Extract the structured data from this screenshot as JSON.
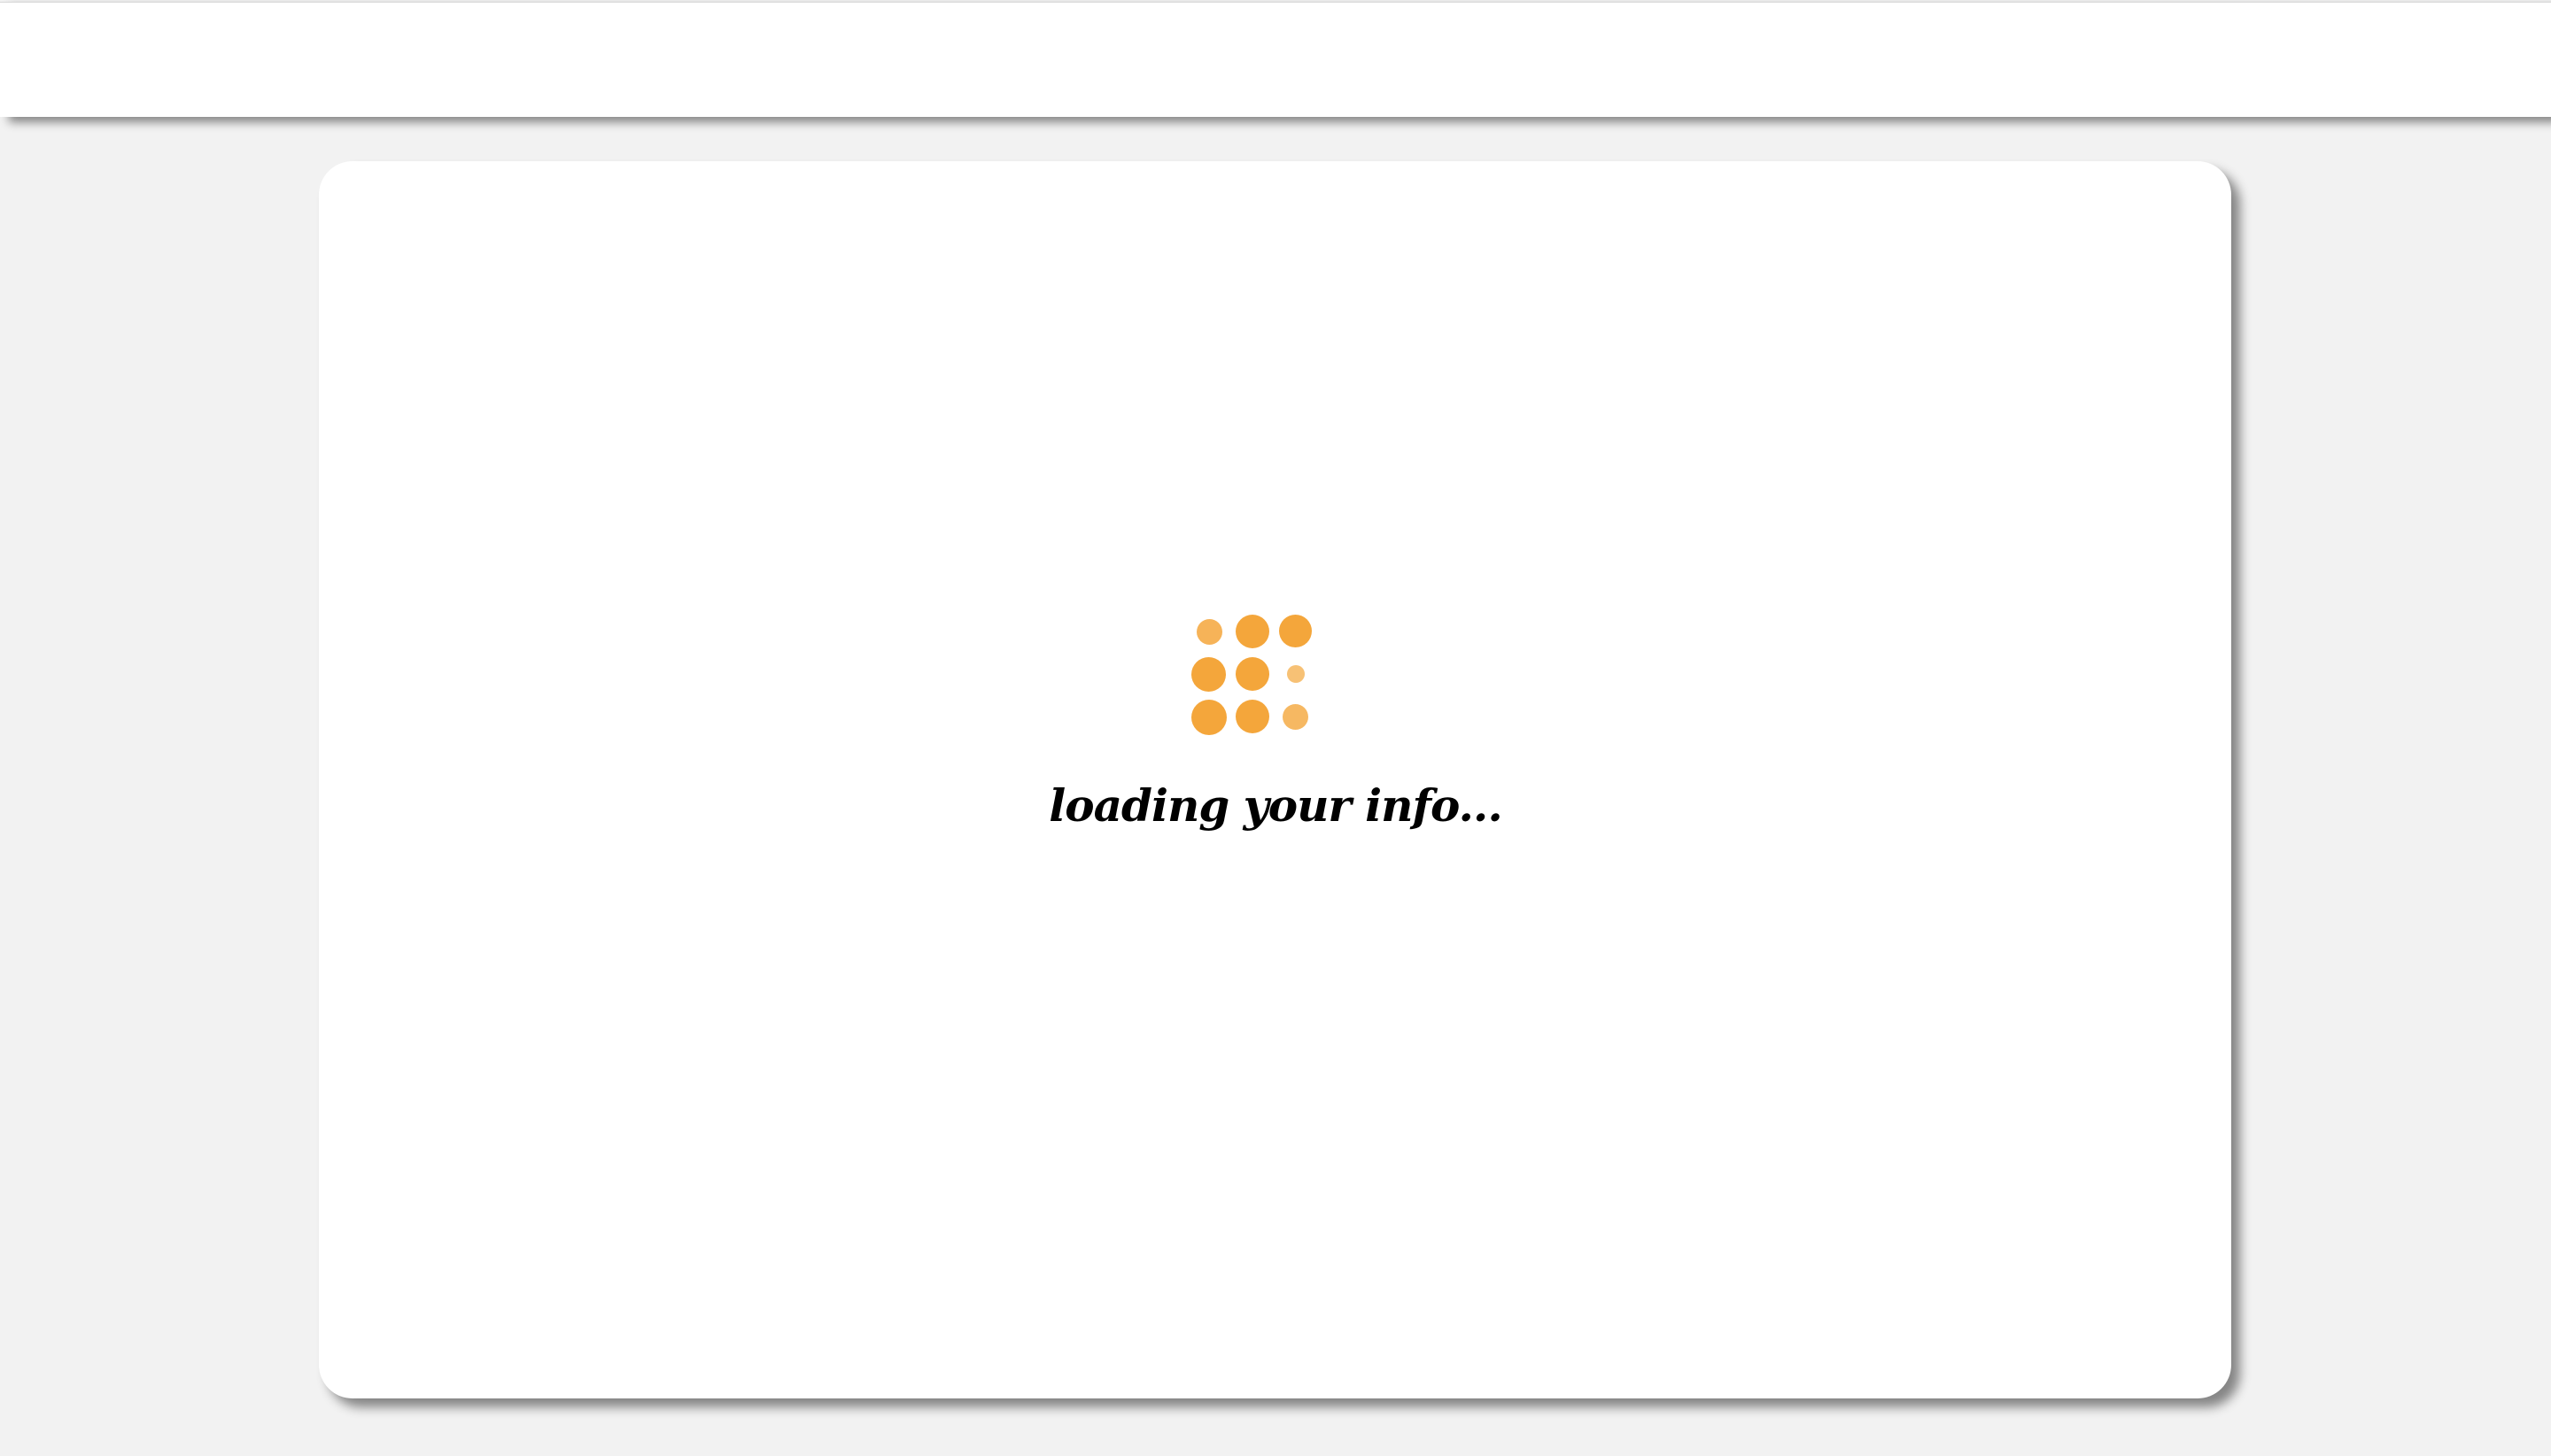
{
  "header": {},
  "loading": {
    "message": "loading your info...",
    "spinner_icon": "dot-grid-spinner-icon",
    "spinner_color": "#f4a63b"
  },
  "colors": {
    "background": "#f2f2f2",
    "card": "#ffffff",
    "accent": "#f4a63b"
  }
}
